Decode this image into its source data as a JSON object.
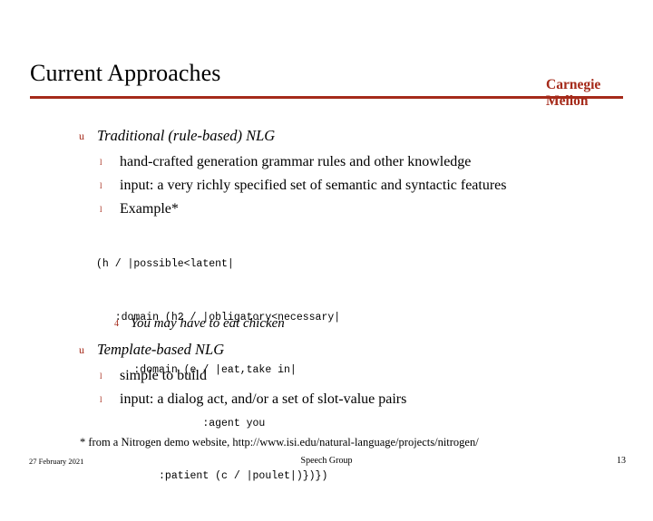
{
  "slide": {
    "title": "Current Approaches",
    "brand_line1": "Carnegie",
    "brand_line2": "Mellon",
    "accent_color": "#a52a1a",
    "bullets": {
      "level1": [
        {
          "marker": "u",
          "text": "Traditional (rule-based) NLG"
        },
        {
          "marker": "u",
          "text": "Template-based NLG"
        }
      ],
      "group1": [
        {
          "marker": "l",
          "text": "hand-crafted generation grammar rules and other knowledge"
        },
        {
          "marker": "l",
          "text": "input: a very richly specified set of semantic and syntactic features"
        },
        {
          "marker": "l",
          "text": "Example*"
        }
      ],
      "group2": [
        {
          "marker": "l",
          "text": "simple to build"
        },
        {
          "marker": "l",
          "text": "input: a dialog act, and/or a set of slot-value pairs"
        }
      ]
    },
    "code_lines": [
      "(h / |possible<latent|",
      "   :domain (h2 / |obligatory<necessary|",
      "      :domain (e / |eat,take in|",
      "                 :agent you",
      "          :patient (c / |poulet|)})})"
    ],
    "dash_bullet": {
      "marker": "4",
      "text": "You may have to eat chicken"
    },
    "footnote": "* from a Nitrogen demo website, http://www.isi.edu/natural-language/projects/nitrogen/",
    "footer": {
      "date": "27 February 2021",
      "center": "Speech Group",
      "page": "13"
    }
  }
}
